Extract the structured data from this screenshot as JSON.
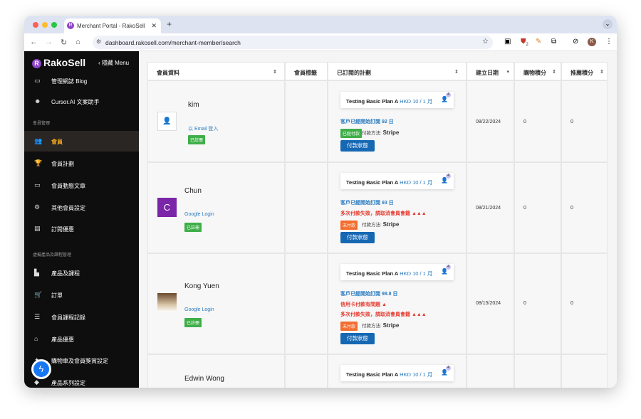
{
  "browser": {
    "tab_title": "Merchant Portal - RakoSell",
    "url": "dashboard.rakosell.com/merchant-member/search",
    "ext_badge": "2",
    "profile_initial": "K"
  },
  "sidebar": {
    "logo": "RakoSell",
    "hide_menu": "隱藏 Menu",
    "items": [
      {
        "label": "管理網誌 Blog",
        "icon": "blog-icon"
      },
      {
        "label": "Cursor.AI 文案助手",
        "icon": "robot-icon"
      },
      {
        "label": "會員",
        "icon": "users-icon"
      },
      {
        "label": "會員計劃",
        "icon": "trophy-icon"
      },
      {
        "label": "會員動態文章",
        "icon": "news-icon"
      },
      {
        "label": "其他會員設定",
        "icon": "gear-icon"
      },
      {
        "label": "訂閱優惠",
        "icon": "coupon-icon"
      },
      {
        "label": "產品及課程",
        "icon": "product-icon"
      },
      {
        "label": "訂單",
        "icon": "cart-icon"
      },
      {
        "label": "會員課程記錄",
        "icon": "list-icon"
      },
      {
        "label": "產品優惠",
        "icon": "store-icon"
      },
      {
        "label": "購物車及會員獎賞設定",
        "icon": "gift-icon"
      },
      {
        "label": "產品系列設定",
        "icon": "tag-icon"
      }
    ],
    "sections": [
      "會員管理",
      "虛擬產品及課程管理"
    ],
    "active": "會員"
  },
  "table": {
    "headers": [
      "會員資料",
      "會員標籤",
      "已訂閱的計劃",
      "建立日期",
      "購物積分",
      "推薦積分"
    ],
    "pay_method_label": "付款方法:",
    "pay_status_button": "付款狀態",
    "fail_warning": "多次付款失敗，請取消會員會籍",
    "card_issue": "信用卡付款有問題",
    "rows": [
      {
        "name": "kim",
        "login": "以 Email 登入",
        "status": "已註冊",
        "plan": "Testing Basic Plan A",
        "price": "HKD 10 / 1 月",
        "count": "4",
        "days": "客戶已經開始訂閱 92 日",
        "pay_badge": "已經付款",
        "method": "Stripe",
        "date": "08/22/2024",
        "shop_points": "0",
        "ref_points": "0"
      },
      {
        "name": "Chun",
        "avatar_letter": "C",
        "login": "Google Login",
        "status": "已註冊",
        "plan": "Testing Basic Plan A",
        "price": "HKD 10 / 1 月",
        "count": "4",
        "days": "客戶已經開始訂閱 93 日",
        "pay_badge": "未付款",
        "method": "Stripe",
        "date": "08/21/2024",
        "shop_points": "0",
        "ref_points": "0"
      },
      {
        "name": "Kong Yuen",
        "login": "Google Login",
        "status": "已註冊",
        "plan": "Testing Basic Plan A",
        "price": "HKD 10 / 1 月",
        "count": "4",
        "days": "客戶已經開始訂閱 98.8 日",
        "pay_badge": "未付款",
        "method": "Stripe",
        "date": "08/15/2024",
        "shop_points": "0",
        "ref_points": "0"
      },
      {
        "name": "Edwin Wong",
        "plan": "Testing Basic Plan A",
        "price": "HKD 10 / 1 月",
        "count": "4"
      }
    ]
  },
  "colors": {
    "accent": "#f0a31c",
    "link": "#2a7bbf",
    "button": "#1668b3",
    "danger": "#e53b30",
    "success": "#3fae49"
  }
}
